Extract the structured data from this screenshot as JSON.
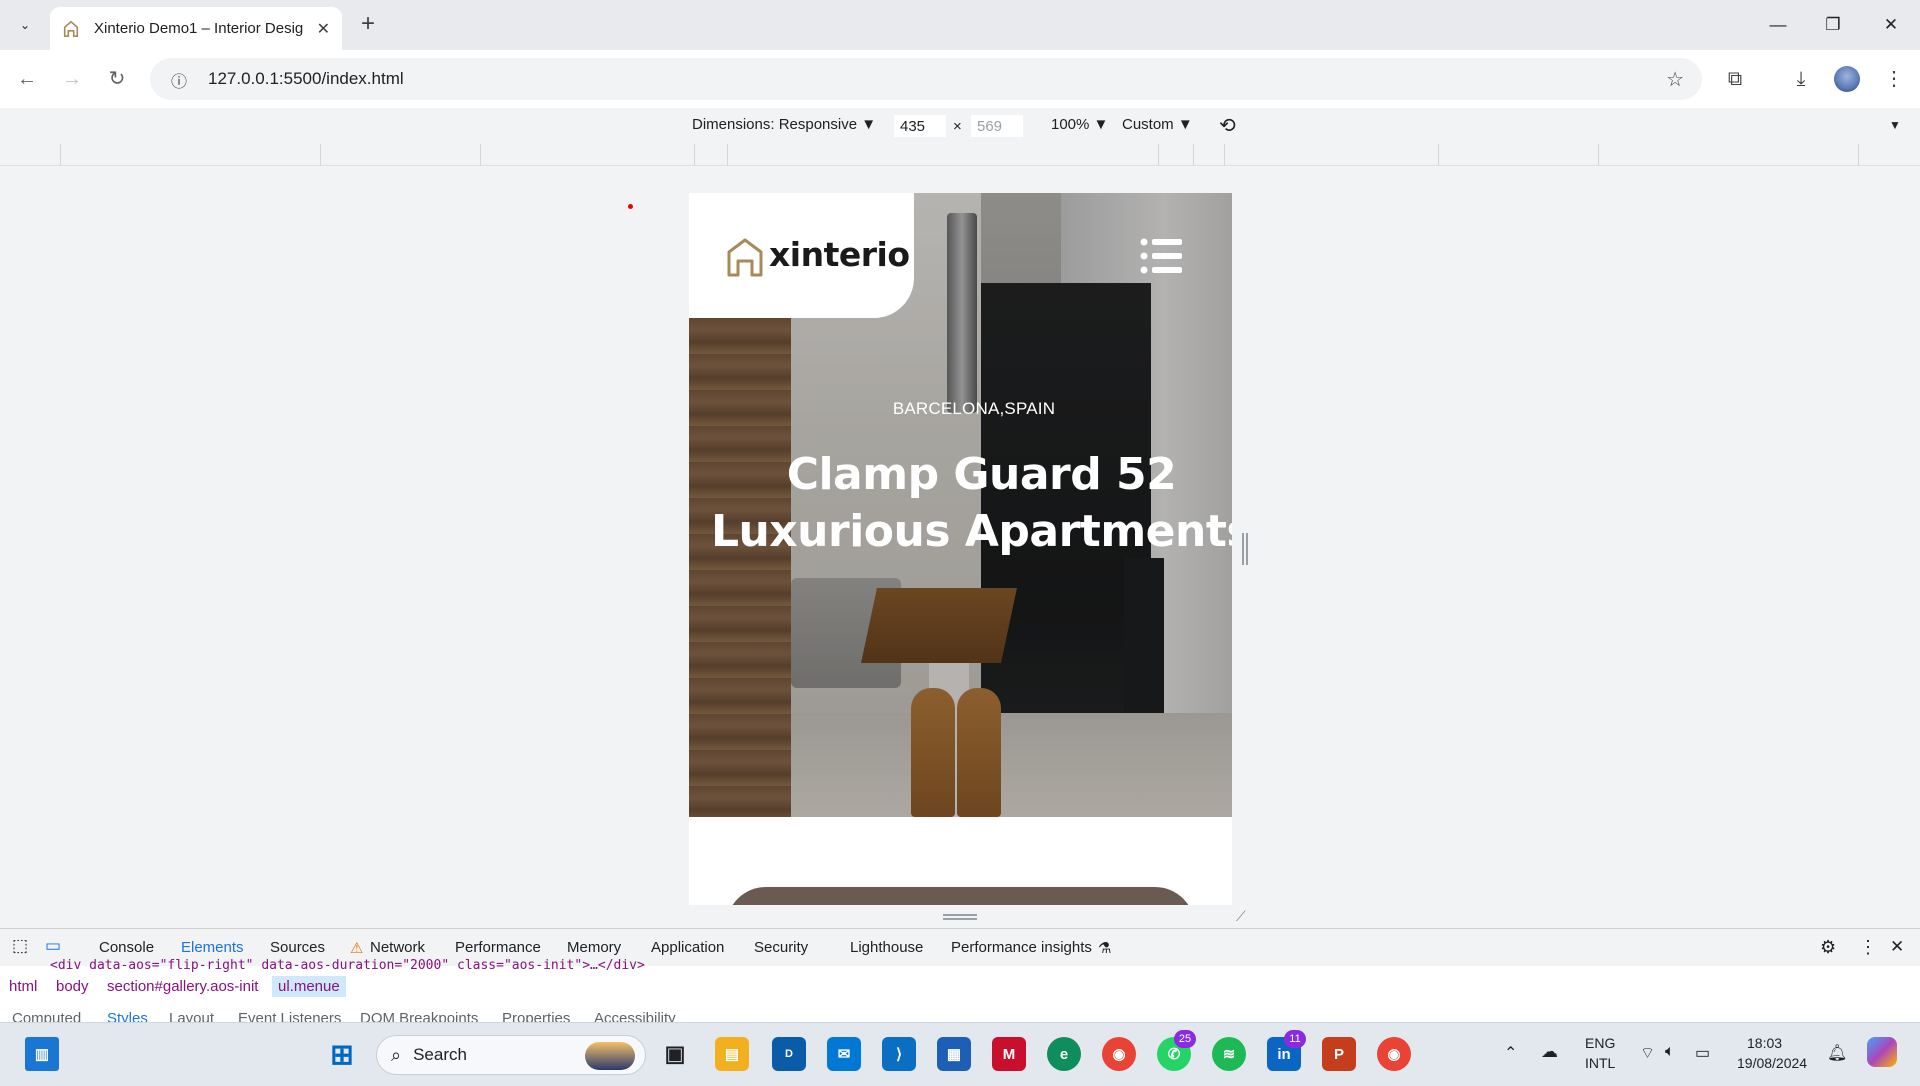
{
  "browser": {
    "tab_title": "Xinterio Demo1 – Interior Desig",
    "url": "127.0.0.1:5500/index.html",
    "new_tab_label": "+",
    "tab_close": "✕"
  },
  "device_toolbar": {
    "dimensions_label": "Dimensions: Responsive ▼",
    "width": "435",
    "times": "×",
    "height": "569",
    "zoom": "100% ▼",
    "throttle": "Custom ▼"
  },
  "page": {
    "logo_text": "xinterio",
    "location": "BARCELONA,SPAIN",
    "title_line1": "Clamp Guard 52",
    "title_line2": "Luxurious Apartments",
    "brand_color": "#a8895a"
  },
  "devtools": {
    "tabs": [
      "Console",
      "Elements",
      "Sources",
      "Network",
      "Performance",
      "Memory",
      "Application",
      "Security",
      "Lighthouse",
      "Performance insights"
    ],
    "active_tab": "Elements",
    "breadcrumb": [
      "html",
      "body",
      "section#gallery.aos-init",
      "ul.menue"
    ],
    "code_line": "<div data-aos=\"flip-right\" data-aos-duration=\"2000\" class=\"aos-init\">…</div>",
    "sub_tabs": [
      "Computed",
      "Styles",
      "Layout",
      "Event Listeners",
      "DOM Breakpoints",
      "Properties",
      "Accessibility"
    ]
  },
  "taskbar": {
    "search_label": "Search",
    "lang_line1": "ENG",
    "lang_line2": "INTL",
    "time": "18:03",
    "date": "19/08/2024",
    "whatsapp_badge": "25",
    "linkedin_badge": "11"
  }
}
